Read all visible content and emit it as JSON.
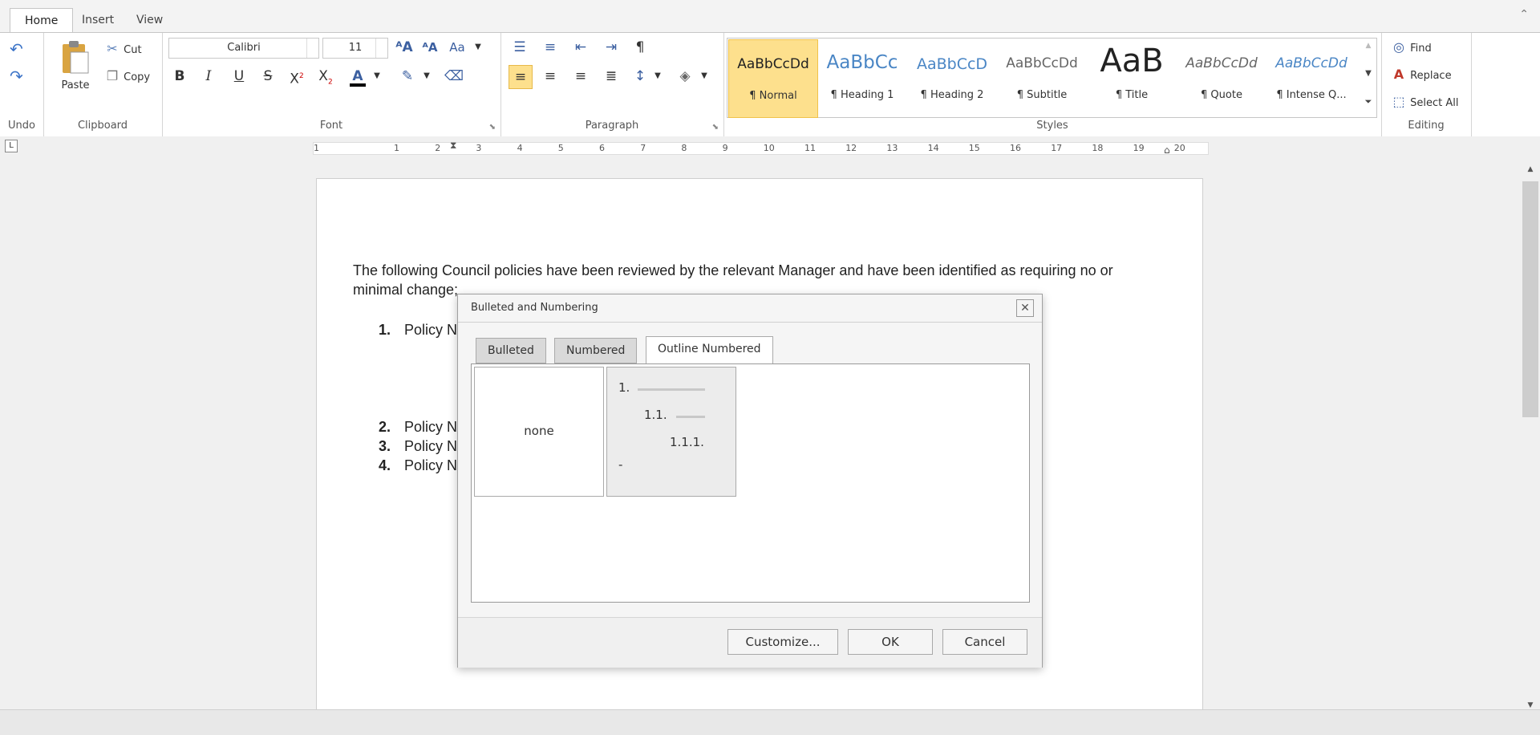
{
  "ribbon_tabs": [
    "Home",
    "Insert",
    "View"
  ],
  "undo": {
    "label": "Undo"
  },
  "clipboard": {
    "paste": "Paste",
    "cut": "Cut",
    "copy": "Copy",
    "label": "Clipboard"
  },
  "font": {
    "name": "Calibri",
    "size": "11",
    "label": "Font"
  },
  "paragraph": {
    "label": "Paragraph"
  },
  "styles": {
    "label": "Styles",
    "items": [
      {
        "sample": "AaBbCcDd",
        "name": "¶ Normal"
      },
      {
        "sample": "AaBbCc",
        "name": "¶ Heading 1"
      },
      {
        "sample": "AaBbCcD",
        "name": "¶ Heading 2"
      },
      {
        "sample": "AaBbCcDd",
        "name": "¶ Subtitle"
      },
      {
        "sample": "AaB",
        "name": "¶ Title"
      },
      {
        "sample": "AaBbCcDd",
        "name": "¶ Quote"
      },
      {
        "sample": "AaBbCcDd",
        "name": "¶ Intense Q..."
      }
    ]
  },
  "editing": {
    "find": "Find",
    "replace": "Replace",
    "select_all": "Select All",
    "label": "Editing"
  },
  "ruler": {
    "ticks": [
      "1",
      "1",
      "2",
      "3",
      "4",
      "5",
      "6",
      "7",
      "8",
      "9",
      "10",
      "11",
      "12",
      "13",
      "14",
      "15",
      "16",
      "17",
      "18",
      "19",
      "20"
    ]
  },
  "document": {
    "intro_line1": "The following Council policies have been reviewed by the relevant Manager and have been identified as requiring no or",
    "intro_line2": "minimal change;",
    "list": [
      {
        "num": "1.",
        "text": "Policy N"
      },
      {
        "num": "2.",
        "text": "Policy N"
      },
      {
        "num": "3.",
        "text": "Policy N"
      },
      {
        "num": "4.",
        "text": "Policy N"
      }
    ]
  },
  "dialog": {
    "title": "Bulleted and Numbering",
    "tabs": [
      "Bulleted",
      "Numbered",
      "Outline Numbered"
    ],
    "none_label": "none",
    "outline": {
      "l1": "1.",
      "l2": "1.1.",
      "l3": "1.1.1.",
      "l4": "-"
    },
    "buttons": {
      "customize": "Customize...",
      "ok": "OK",
      "cancel": "Cancel"
    }
  },
  "colors": {
    "accent_style": "#fde08d",
    "font_color_bar": "#000000"
  }
}
